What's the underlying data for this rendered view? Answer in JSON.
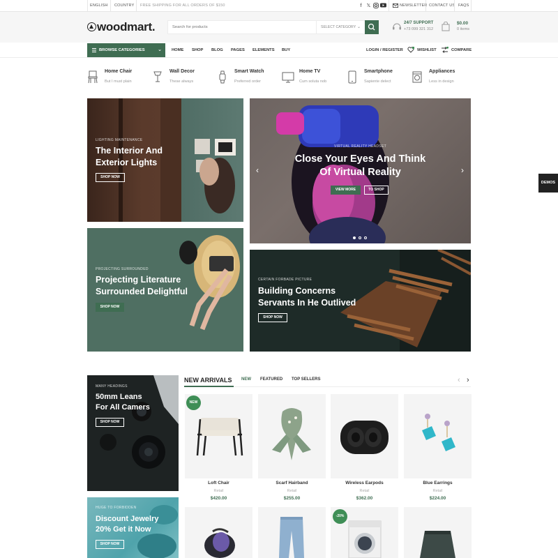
{
  "topbar": {
    "language": "ENGLISH",
    "country": "COUNTRY",
    "shipping": "FREE SHIPPING FOR ALL ORDERS OF $150",
    "newsletter": "NEWSLETTER",
    "contact": "CONTACT US",
    "faqs": "FAQS",
    "social_icons": [
      "facebook-icon",
      "x-icon",
      "instagram-icon",
      "youtube-icon"
    ]
  },
  "header": {
    "logo": "woodmart.",
    "search_placeholder": "Search for products",
    "category_select": "SELECT CATEGORY",
    "support_title": "24/7 SUPPORT",
    "support_phone": "+73 099 321 312",
    "cart_total": "$0.00",
    "cart_items": "0 items"
  },
  "nav": {
    "browse": "BROWSE CATEGORIES",
    "items": [
      "HOME",
      "SHOP",
      "BLOG",
      "PAGES",
      "ELEMENTS",
      "BUY"
    ],
    "login": "LOGIN / REGISTER",
    "wishlist": "WISHLIST",
    "compare": "COMPARE"
  },
  "categories": [
    {
      "title": "Home Chair",
      "sub": "But I must plain",
      "icon": "chair-icon"
    },
    {
      "title": "Wall Decor",
      "sub": "These always",
      "icon": "lamp-icon"
    },
    {
      "title": "Smart Watch",
      "sub": "Preferred order",
      "icon": "watch-icon"
    },
    {
      "title": "Home TV",
      "sub": "Cum soluta nob",
      "icon": "tv-icon"
    },
    {
      "title": "Smartphone",
      "sub": "Sapiente delect",
      "icon": "smartphone-icon"
    },
    {
      "title": "Appliances",
      "sub": "Less in design",
      "icon": "washer-icon"
    }
  ],
  "banners": {
    "interior": {
      "kicker": "LIGHTING MAINTENANCE",
      "title": "The Interior And\nExterior Lights",
      "button": "SHOP NOW"
    },
    "vr": {
      "kicker": "VIRTUAL REALITY HEADSET",
      "title": "Close Your Eyes And Think\nOf Virtual Reality",
      "button1": "VIEW MORE",
      "button2": "TO SHOP"
    },
    "literature": {
      "kicker": "PROJECTING SURROUNDED",
      "title": "Projecting Literature\nSurrounded Delightful",
      "button": "SHOP NOW"
    },
    "building": {
      "kicker": "CERTAIN FORBADE PICTURE",
      "title": "Building Concerns\nServants In He Outlived",
      "button": "SHOP NOW"
    },
    "lens": {
      "kicker": "MANY HEADINGS",
      "title": "50mm Leans\nFor All Camers",
      "button": "SHOP NOW"
    },
    "jewelry": {
      "kicker": "HUGE TO FORBIDDEN",
      "title": "Discount Jewelry\n20% Get it Now",
      "button": "SHOP NOW"
    }
  },
  "demos": "DEMOS",
  "products_section": {
    "title": "NEW ARRIVALS",
    "tabs": [
      "NEW",
      "FEATURED",
      "TOP SELLERS"
    ],
    "products": [
      {
        "name": "Loft Chair",
        "category": "Retail",
        "price": "$420.00",
        "badge": "NEW"
      },
      {
        "name": "Scarf Hairband",
        "category": "Retail",
        "price": "$255.00",
        "badge": ""
      },
      {
        "name": "Wireless Earpods",
        "category": "Retail",
        "price": "$362.00",
        "badge": ""
      },
      {
        "name": "Blue Earrings",
        "category": "Retail",
        "price": "$224.00",
        "badge": ""
      }
    ],
    "row2_badge": "-20%"
  },
  "colors": {
    "accent": "#3f6d52",
    "badge": "#3f8e56"
  }
}
